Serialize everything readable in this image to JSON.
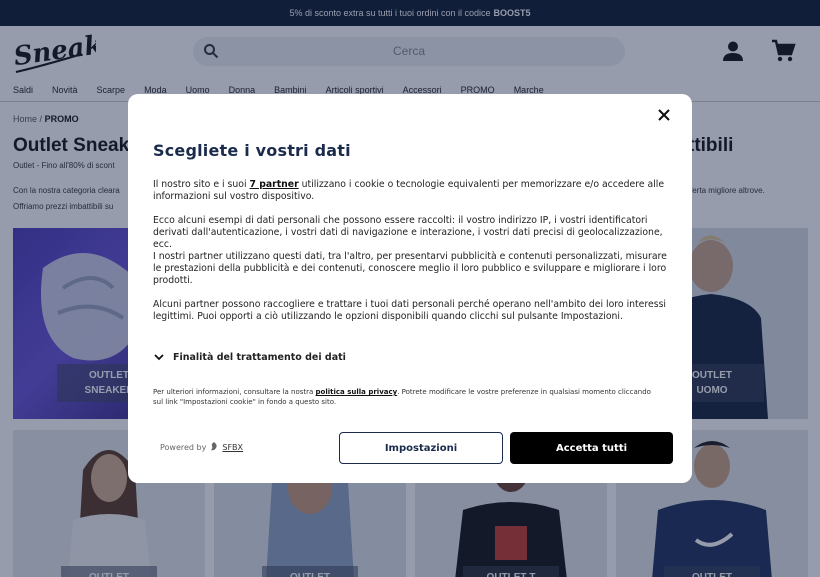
{
  "promo_bar": {
    "text": "5% di sconto extra su tutti i tuoi ordini con il codice",
    "code": "BOOST5"
  },
  "header": {
    "logo_text": "Sneakin",
    "search_placeholder": "Cerca"
  },
  "nav": {
    "items": [
      "Saldi",
      "Novità",
      "Scarpe",
      "Moda",
      "Uomo",
      "Donna",
      "Bambini",
      "Articoli sportivi",
      "Accessori",
      "PROMO",
      "Marche"
    ]
  },
  "breadcrumb": {
    "home": "Home",
    "separator": "/",
    "current": "PROMO"
  },
  "page": {
    "title_left": "Outlet Sneak",
    "title_right": "ttibili",
    "subtitle": "Outlet - Fino all'80% di scont",
    "desc_line1_left": "Con la nostra categoria cleara",
    "desc_line1_right": "fferta migliore altrove.",
    "desc_line2_left": "Offriamo prezzi imbattibili su"
  },
  "tiles": {
    "sneakers": {
      "line1": "OUTLET",
      "line2": "SNEAKER"
    },
    "uomo": {
      "line1": "OUTLET",
      "line2": "UOMO"
    },
    "row2": [
      "OUTLET",
      "OUTLET",
      "OUTLET T",
      "OUTLET"
    ]
  },
  "modal": {
    "title": "Scegliete i vostri dati",
    "p1_before": "Il nostro sito e i suoi ",
    "p1_link": "7 partner",
    "p1_after": " utilizzano i cookie o tecnologie equivalenti per memorizzare e/o accedere alle informazioni sul vostro dispositivo.",
    "p2": "Ecco alcuni esempi di dati personali che possono essere raccolti: il vostro indirizzo IP, i vostri identificatori derivati dall'autenticazione, i vostri dati di navigazione e interazione, i vostri dati precisi di geolocalizzazione, ecc.",
    "p3": "I nostri partner utilizzano questi dati, tra l'altro, per presentarvi pubblicità e contenuti personalizzati, misurare le prestazioni della pubblicità e dei contenuti, conoscere meglio il loro pubblico e sviluppare e migliorare i loro prodotti.",
    "p4": "Alcuni partner possono raccogliere e trattare i tuoi dati personali perché operano nell'ambito dei loro interessi legittimi. Puoi opporti a ciò utilizzando le opzioni disponibili quando clicchi sul pulsante Impostazioni.",
    "purposes_label": "Finalità del trattamento dei dati",
    "footnote_before": "Per ulteriori informazioni, consultare la nostra ",
    "footnote_link": "politica sulla privacy",
    "footnote_after": ". Potrete modificare le vostre preferenze in qualsiasi momento cliccando sul link \"Impostazioni cookie\" in fondo a questo sito.",
    "powered_by": "Powered by",
    "powered_brand": "SFBX",
    "settings_label": "Impostazioni",
    "accept_label": "Accetta tutti"
  },
  "colors": {
    "promo_bg": "#0c1a2e",
    "title_color": "#1a2b4c",
    "accept_bg": "#000000",
    "overlay": "rgba(22,36,70,0.45)"
  }
}
